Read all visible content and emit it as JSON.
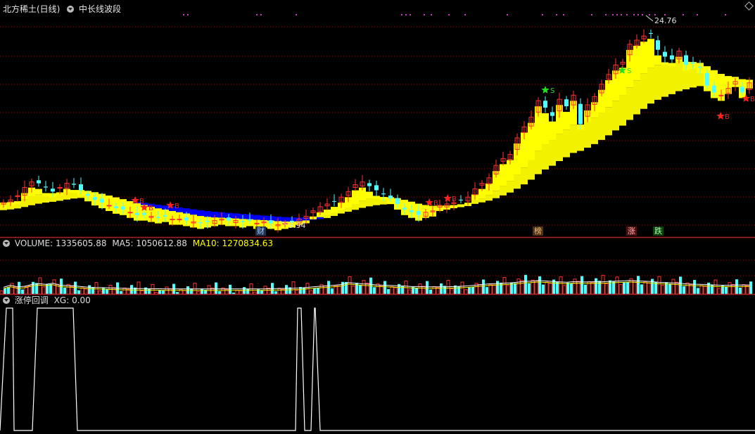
{
  "header": {
    "stock_title": "北方稀土(日线)",
    "indicator_name": "中长线波段"
  },
  "volume_panel": {
    "label": "VOLUME:",
    "volume_value": "1335605.88",
    "ma5_label": "MA5:",
    "ma5_value": "1050612.88",
    "ma10_label": "MA10:",
    "ma10_value": "1270834.63"
  },
  "signal_panel": {
    "label": "涨停回调",
    "xg_label": "XG:",
    "xg_value": "0.00"
  },
  "markers": {
    "high": "24.76",
    "low": "9.94",
    "events": [
      "财",
      "榜",
      "涨",
      "跌"
    ],
    "buy": "B",
    "sell": "S"
  },
  "colors": {
    "up": "#ff3232",
    "down": "#54ffff",
    "band_yellow": "#ffff00",
    "band_blue": "#0000ff",
    "grid": "#801010",
    "signal_line": "#ffffff",
    "buy_star": "#ff2020",
    "sell_star": "#20e020",
    "magenta_dots": "#c040c0"
  },
  "chart_data": [
    {
      "type": "line",
      "title": "北方稀土(日线) 中长线波段",
      "x": [
        0,
        10,
        20,
        30,
        40,
        50,
        60,
        70,
        80,
        90,
        100,
        110,
        120,
        130,
        140,
        150,
        160,
        170,
        180,
        190,
        200,
        210,
        220,
        230,
        240,
        250,
        260,
        270,
        280,
        290,
        300,
        310,
        320,
        330,
        340,
        350,
        360,
        370,
        380,
        390,
        400,
        410,
        420,
        430,
        440,
        450,
        460,
        470,
        480,
        490,
        500,
        510,
        520,
        530,
        540,
        550,
        560,
        570,
        580,
        590,
        600,
        610,
        620,
        630,
        640,
        650,
        660,
        670,
        680,
        690,
        700,
        710,
        720,
        730,
        740,
        750,
        760,
        770,
        780,
        790,
        800,
        810,
        820,
        830,
        840,
        850,
        860,
        870,
        880,
        890,
        900,
        910,
        920,
        930,
        940,
        950,
        960,
        970,
        980,
        990,
        1000,
        1010,
        1020,
        1030,
        1040,
        1050,
        1060
      ],
      "series": [
        {
          "values": [
            11.8,
            12.0,
            12.3,
            12.9,
            13.3,
            13.2,
            12.9,
            12.6,
            12.9,
            13.2,
            13.1,
            12.7,
            12.3,
            12.0,
            11.8,
            11.6,
            11.4,
            11.3,
            11.1,
            10.9,
            10.9,
            10.8,
            10.7,
            10.8,
            10.6,
            10.6,
            10.5,
            10.4,
            10.3,
            10.4,
            10.5,
            10.6,
            10.5,
            10.5,
            10.4,
            10.5,
            10.3,
            10.4,
            10.3,
            10.2,
            10.3,
            10.4,
            10.6,
            10.8,
            11.2,
            11.5,
            11.7,
            11.9,
            12.2,
            12.6,
            13.1,
            13.3,
            13.0,
            12.7,
            12.4,
            12.1,
            11.7,
            11.3,
            11.1,
            10.9,
            11.1,
            11.2,
            11.6,
            11.7,
            11.8,
            12.0,
            12.2,
            12.8,
            13.2,
            13.6,
            14.5,
            15.0,
            15.3,
            16.5,
            17.3,
            18.0,
            19.2,
            18.7,
            18.1,
            19.3,
            18.8,
            19.6,
            17.5,
            18.9,
            19.5,
            20.4,
            21.1,
            21.8,
            22.0,
            23.3,
            23.6,
            23.9,
            24.1,
            22.9,
            22.4,
            22.2,
            22.8,
            21.8,
            21.9,
            21.6,
            20.3,
            19.8,
            19.6,
            20.1,
            20.6,
            19.8,
            20.5
          ]
        }
      ],
      "yrange": [
        9.4,
        25.8
      ]
    },
    {
      "type": "bar",
      "title": "VOLUME",
      "values": [
        1.05,
        1.2,
        1.08,
        1.12,
        1.25,
        1.32,
        1.27,
        1.35,
        1.2,
        1.18,
        1.15,
        1.1,
        1.06,
        1.03,
        1.02,
        1.0,
        0.98,
        0.97,
        0.96,
        0.95,
        0.95,
        0.94,
        0.94,
        0.93,
        0.93,
        0.93,
        0.92,
        0.92,
        0.92,
        0.92,
        0.92,
        0.92,
        0.92,
        0.92,
        0.92,
        0.93,
        0.93,
        0.93,
        0.94,
        0.95,
        0.96,
        0.97,
        0.99,
        1.03,
        1.08,
        1.12,
        1.15,
        1.2,
        1.25,
        1.4,
        1.35,
        1.3,
        1.28,
        1.22,
        1.2,
        1.18,
        1.15,
        1.14,
        1.1,
        1.1,
        1.08,
        1.08,
        1.08,
        1.08,
        1.1,
        1.12,
        1.15,
        1.2,
        1.25,
        1.3,
        1.32,
        1.35,
        1.38,
        1.42,
        1.48,
        1.5,
        1.55,
        1.52,
        1.48,
        1.45,
        1.42,
        1.46,
        1.45,
        1.44,
        1.46,
        1.45,
        1.48,
        1.5,
        1.52,
        1.55,
        1.52,
        1.5,
        1.47,
        1.42,
        1.4,
        1.38,
        1.35,
        1.3,
        1.28,
        1.27,
        1.25,
        1.22,
        1.2,
        1.2,
        1.21,
        1.22,
        1.22
      ],
      "ylim": [
        0,
        1.9
      ]
    },
    {
      "type": "line",
      "title": "涨停回调",
      "x": [
        0,
        9,
        10,
        18,
        20,
        46,
        53,
        60,
        100,
        104,
        110,
        420,
        423,
        428,
        433,
        440,
        442,
        447,
        448,
        455,
        458,
        1073
      ],
      "values": [
        0,
        1,
        1,
        1,
        0,
        0,
        1,
        1,
        1,
        1,
        0,
        0,
        1,
        1,
        0,
        0,
        0,
        1,
        1,
        0,
        0,
        0
      ],
      "ylim": [
        0,
        1
      ]
    }
  ]
}
